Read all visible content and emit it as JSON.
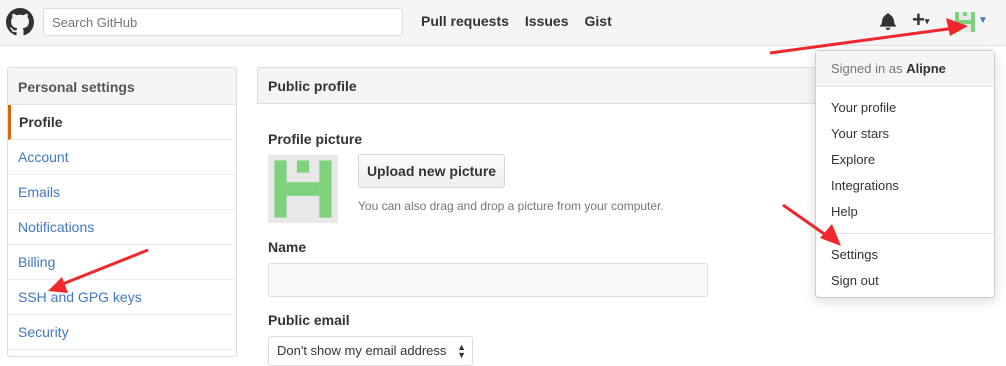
{
  "header": {
    "search_placeholder": "Search GitHub",
    "nav": [
      "Pull requests",
      "Issues",
      "Gist"
    ],
    "plus_label": "+"
  },
  "sidebar": {
    "title": "Personal settings",
    "items": [
      {
        "label": "Profile",
        "selected": true
      },
      {
        "label": "Account",
        "selected": false
      },
      {
        "label": "Emails",
        "selected": false
      },
      {
        "label": "Notifications",
        "selected": false
      },
      {
        "label": "Billing",
        "selected": false
      },
      {
        "label": "SSH and GPG keys",
        "selected": false
      },
      {
        "label": "Security",
        "selected": false
      }
    ]
  },
  "main": {
    "title": "Public profile",
    "picture_label": "Profile picture",
    "upload_label": "Upload new picture",
    "upload_hint": "You can also drag and drop a picture from your computer.",
    "name_label": "Name",
    "email_label": "Public email",
    "email_value": "Don't show my email address"
  },
  "dropdown": {
    "signed_in_prefix": "Signed in as",
    "username": "Alipne",
    "items": [
      "Your profile",
      "Your stars",
      "Explore",
      "Integrations",
      "Help",
      "Settings",
      "Sign out"
    ]
  },
  "colors": {
    "accent_link": "#4078c0",
    "selected_border": "#d26911",
    "avatar_green": "#7ed27e",
    "annotation_red": "#f0282d"
  },
  "icons": [
    "github-logo-icon",
    "bell-icon",
    "plus-icon",
    "caret-down-icon",
    "select-arrows-icon"
  ]
}
